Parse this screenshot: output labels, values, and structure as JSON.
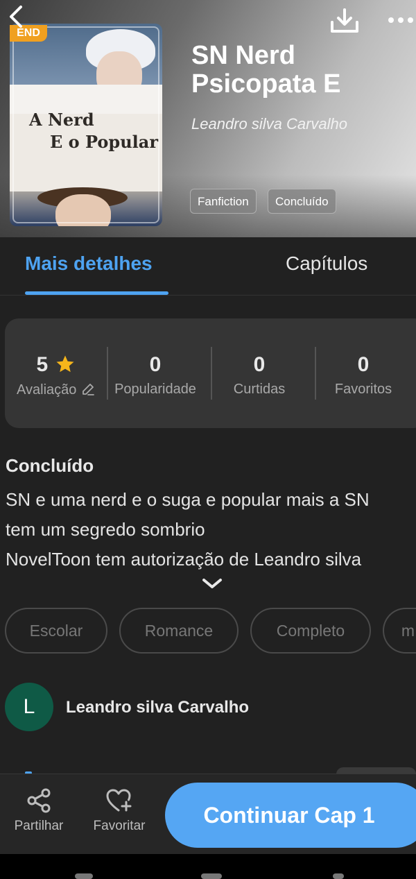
{
  "header": {
    "status_badge": "END",
    "cover": {
      "title_line1": "A Nerd",
      "title_line2": "E o Popular"
    },
    "title_line1": "SN Nerd",
    "title_line2": "Psicopata E",
    "author": "Leandro silva Carvalho",
    "tags": [
      "Fanfiction",
      "Concluído"
    ]
  },
  "icons": {
    "back": "chevron-left-icon",
    "download": "download-icon",
    "more": "more-horizontal-icon",
    "star": "star-icon",
    "edit": "pencil-icon",
    "share": "share-icon",
    "favorite": "heart-plus-icon"
  },
  "tabs": {
    "details": "Mais detalhes",
    "chapters": "Capítulos"
  },
  "stats": [
    {
      "value": "5",
      "label": "Avaliação"
    },
    {
      "value": "0",
      "label": "Popularidade"
    },
    {
      "value": "0",
      "label": "Curtidas"
    },
    {
      "value": "0",
      "label": "Favoritos"
    }
  ],
  "description": {
    "status": "Concluído",
    "lines": [
      "SN e uma nerd  e o suga e popular mais a SN",
      "tem um segredo sombrio",
      "NovelToon tem autorização de Leandro silva"
    ]
  },
  "genres": [
    "Escolar",
    "Romance",
    "Completo",
    "m"
  ],
  "author_card": {
    "initial": "L",
    "name": "Leandro silva Carvalho"
  },
  "bottom_bar": {
    "share_label": "Partilhar",
    "favorite_label": "Favoritar",
    "continue_label": "Continuar Cap 1"
  },
  "colors": {
    "accent": "#4ea3f1",
    "continue_button": "#55a6f3",
    "badge": "#f0a020",
    "avatar": "#0f5a46",
    "star": "#f5b51b",
    "background": "#212121"
  }
}
